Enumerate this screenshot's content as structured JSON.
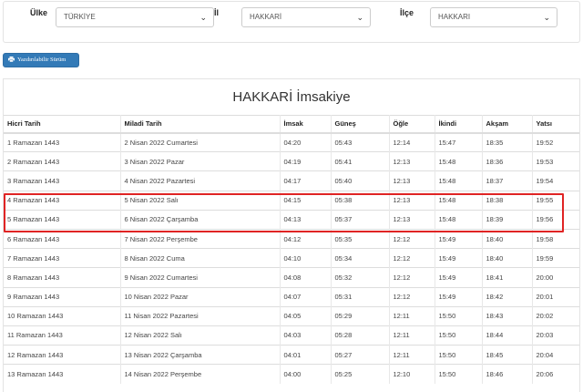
{
  "filters": {
    "country_label": "Ülke",
    "country_value": "TÜRKİYE",
    "province_label": "İl",
    "province_value": "HAKKARİ",
    "district_label": "İlçe",
    "district_value": "HAKKARI"
  },
  "print_button": {
    "label": "Yazdırılabilir Sürüm",
    "icon": "printer-icon",
    "color": "#337ab7"
  },
  "table": {
    "title": "HAKKARİ İmsakiye",
    "headers": [
      "Hicri Tarih",
      "Miladi Tarih",
      "İmsak",
      "Güneş",
      "Öğle",
      "İkindi",
      "Akşam",
      "Yatsı"
    ],
    "rows": [
      [
        "1 Ramazan 1443",
        "2 Nisan 2022 Cumartesi",
        "04:20",
        "05:43",
        "12:14",
        "15:47",
        "18:35",
        "19:52"
      ],
      [
        "2 Ramazan 1443",
        "3 Nisan 2022 Pazar",
        "04:19",
        "05:41",
        "12:13",
        "15:48",
        "18:36",
        "19:53"
      ],
      [
        "3 Ramazan 1443",
        "4 Nisan 2022 Pazartesi",
        "04:17",
        "05:40",
        "12:13",
        "15:48",
        "18:37",
        "19:54"
      ],
      [
        "4 Ramazan 1443",
        "5 Nisan 2022 Salı",
        "04:15",
        "05:38",
        "12:13",
        "15:48",
        "18:38",
        "19:55"
      ],
      [
        "5 Ramazan 1443",
        "6 Nisan 2022 Çarşamba",
        "04:13",
        "05:37",
        "12:13",
        "15:48",
        "18:39",
        "19:56"
      ],
      [
        "6 Ramazan 1443",
        "7 Nisan 2022 Perşembe",
        "04:12",
        "05:35",
        "12:12",
        "15:49",
        "18:40",
        "19:58"
      ],
      [
        "7 Ramazan 1443",
        "8 Nisan 2022 Cuma",
        "04:10",
        "05:34",
        "12:12",
        "15:49",
        "18:40",
        "19:59"
      ],
      [
        "8 Ramazan 1443",
        "9 Nisan 2022 Cumartesi",
        "04:08",
        "05:32",
        "12:12",
        "15:49",
        "18:41",
        "20:00"
      ],
      [
        "9 Ramazan 1443",
        "10 Nisan 2022 Pazar",
        "04:07",
        "05:31",
        "12:12",
        "15:49",
        "18:42",
        "20:01"
      ],
      [
        "10 Ramazan 1443",
        "11 Nisan 2022 Pazartesi",
        "04:05",
        "05:29",
        "12:11",
        "15:50",
        "18:43",
        "20:02"
      ],
      [
        "11 Ramazan 1443",
        "12 Nisan 2022 Salı",
        "04:03",
        "05:28",
        "12:11",
        "15:50",
        "18:44",
        "20:03"
      ],
      [
        "12 Ramazan 1443",
        "13 Nisan 2022 Çarşamba",
        "04:01",
        "05:27",
        "12:11",
        "15:50",
        "18:45",
        "20:04"
      ],
      [
        "13 Ramazan 1443",
        "14 Nisan 2022 Perşembe",
        "04:00",
        "05:25",
        "12:10",
        "15:50",
        "18:46",
        "20:06"
      ]
    ],
    "highlight_color": "#e02424"
  }
}
